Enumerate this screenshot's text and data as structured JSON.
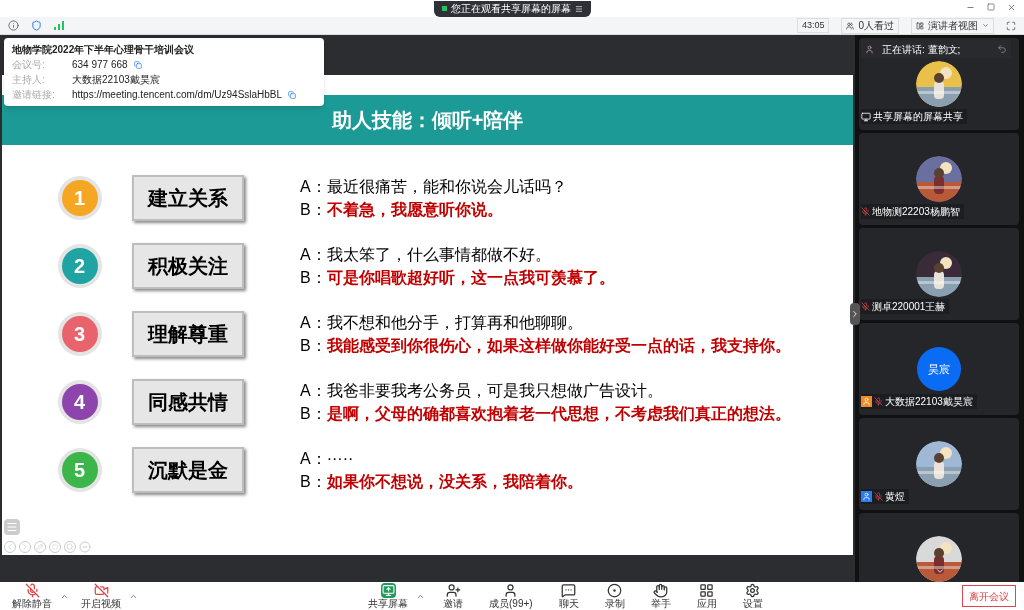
{
  "top_banner": {
    "text": "您正在观看共享屏幕的屏幕"
  },
  "status_bar": {
    "timer": "43:05",
    "viewers": "0人看过",
    "view_mode": "演讲者视图"
  },
  "meeting_info": {
    "title": "地物学院2022年下半年心理骨干培训会议",
    "fields": [
      {
        "label": "会议号:",
        "value": "634 977 668",
        "copyable": true
      },
      {
        "label": "主持人:",
        "value": "大数据22103戴昊宸",
        "copyable": false
      },
      {
        "label": "邀请链接:",
        "value": "https://meeting.tencent.com/dm/Uz94SslaHbBL",
        "copyable": true
      }
    ]
  },
  "slide": {
    "title": "助人技能：倾听+陪伴",
    "items": [
      {
        "number": "1",
        "color": "#f5a623",
        "label": "建立关系",
        "lines": [
          {
            "speaker": "A：",
            "text": "最近很痛苦，能和你说会儿话吗？",
            "emphasis": false
          },
          {
            "speaker": "B：",
            "text": "不着急，我愿意听你说。",
            "emphasis": true
          }
        ]
      },
      {
        "number": "2",
        "color": "#1fa3a3",
        "label": "积极关注",
        "lines": [
          {
            "speaker": "A：",
            "text": "我太笨了，什么事情都做不好。",
            "emphasis": false
          },
          {
            "speaker": "B：",
            "text": "可是你唱歌超好听，这一点我可羡慕了。",
            "emphasis": true
          }
        ]
      },
      {
        "number": "3",
        "color": "#e8636b",
        "label": "理解尊重",
        "lines": [
          {
            "speaker": "A：",
            "text": "我不想和他分手，打算再和他聊聊。",
            "emphasis": false
          },
          {
            "speaker": "B：",
            "text": "我能感受到你很伤心，如果这样做你能好受一点的话，我支持你。",
            "emphasis": true
          }
        ]
      },
      {
        "number": "4",
        "color": "#8e44ad",
        "label": "同感共情",
        "lines": [
          {
            "speaker": "A：",
            "text": "我爸非要我考公务员，可是我只想做广告设计。",
            "emphasis": false
          },
          {
            "speaker": "B：",
            "text": "是啊，父母的确都喜欢抱着老一代思想，不考虑我们真正的想法。",
            "emphasis": true
          }
        ]
      },
      {
        "number": "5",
        "color": "#3cb54a",
        "label": "沉默是金",
        "lines": [
          {
            "speaker": "A：",
            "text": "·····",
            "emphasis": false
          },
          {
            "speaker": "B：",
            "text": "如果你不想说，没关系，我陪着你。",
            "emphasis": true
          }
        ]
      }
    ]
  },
  "speaking": {
    "text": "正在讲话: 董韵文;"
  },
  "participants": [
    {
      "name": "共享屏幕的屏幕共享",
      "badge": {
        "kind": "sharer"
      },
      "muted": false,
      "avatar": {
        "kind": "picture"
      }
    },
    {
      "name": "地物测22203杨鹏智",
      "muted": true,
      "avatar": {
        "kind": "picture"
      }
    },
    {
      "name": "测卓220001王赫",
      "muted": true,
      "avatar": {
        "kind": "picture"
      }
    },
    {
      "name": "大数据22103戴昊宸",
      "badge": {
        "kind": "host"
      },
      "muted": true,
      "avatar": {
        "kind": "initials",
        "initials": "昊宸"
      }
    },
    {
      "name": "黄煜",
      "badge": {
        "kind": "cohost"
      },
      "muted": true,
      "avatar": {
        "kind": "picture"
      }
    },
    {
      "avatar": {
        "kind": "picture"
      }
    }
  ],
  "toolbar": {
    "left": [
      {
        "kind": "mic",
        "label": "解除静音",
        "has_menu": true
      },
      {
        "kind": "video",
        "label": "开启视频",
        "has_menu": true
      }
    ],
    "center": [
      {
        "kind": "share",
        "label": "共享屏幕",
        "has_menu": true
      },
      {
        "kind": "invite",
        "label": "邀请",
        "has_menu": false
      },
      {
        "kind": "members",
        "label": "成员(99+)",
        "has_menu": false
      },
      {
        "kind": "chat",
        "label": "聊天",
        "has_menu": false
      },
      {
        "kind": "record",
        "label": "录制",
        "has_menu": false
      },
      {
        "kind": "hand",
        "label": "举手",
        "has_menu": false
      },
      {
        "kind": "apps",
        "label": "应用",
        "has_menu": false
      },
      {
        "kind": "settings",
        "label": "设置",
        "has_menu": false
      }
    ],
    "leave": "离开会议"
  }
}
